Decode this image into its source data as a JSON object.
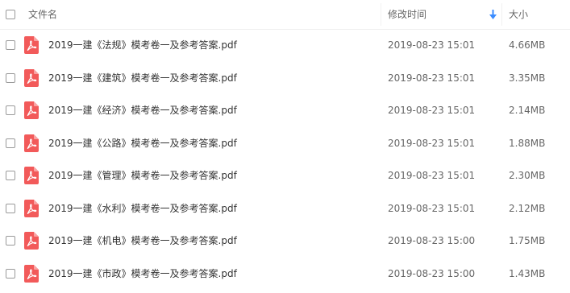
{
  "header": {
    "name_label": "文件名",
    "modified_label": "修改时间",
    "size_label": "大小",
    "sort_indicator": "arrow-down-icon"
  },
  "colors": {
    "pdf_icon": "#f25a5a",
    "sort_arrow": "#3b8cff",
    "text": "#333333",
    "muted_text": "#666666"
  },
  "files": [
    {
      "name": "2019一建《法规》模考卷一及参考答案.pdf",
      "modified": "2019-08-23 15:01",
      "size": "4.66MB",
      "icon": "pdf-icon"
    },
    {
      "name": "2019一建《建筑》模考卷一及参考答案.pdf",
      "modified": "2019-08-23 15:01",
      "size": "3.35MB",
      "icon": "pdf-icon"
    },
    {
      "name": "2019一建《经济》模考卷一及参考答案.pdf",
      "modified": "2019-08-23 15:01",
      "size": "2.14MB",
      "icon": "pdf-icon"
    },
    {
      "name": "2019一建《公路》模考卷一及参考答案.pdf",
      "modified": "2019-08-23 15:01",
      "size": "1.88MB",
      "icon": "pdf-icon"
    },
    {
      "name": "2019一建《管理》模考卷一及参考答案.pdf",
      "modified": "2019-08-23 15:01",
      "size": "2.30MB",
      "icon": "pdf-icon"
    },
    {
      "name": "2019一建《水利》模考卷一及参考答案.pdf",
      "modified": "2019-08-23 15:01",
      "size": "2.12MB",
      "icon": "pdf-icon"
    },
    {
      "name": "2019一建《机电》模考卷一及参考答案.pdf",
      "modified": "2019-08-23 15:00",
      "size": "1.75MB",
      "icon": "pdf-icon"
    },
    {
      "name": "2019一建《市政》模考卷一及参考答案.pdf",
      "modified": "2019-08-23 15:00",
      "size": "1.43MB",
      "icon": "pdf-icon"
    }
  ]
}
